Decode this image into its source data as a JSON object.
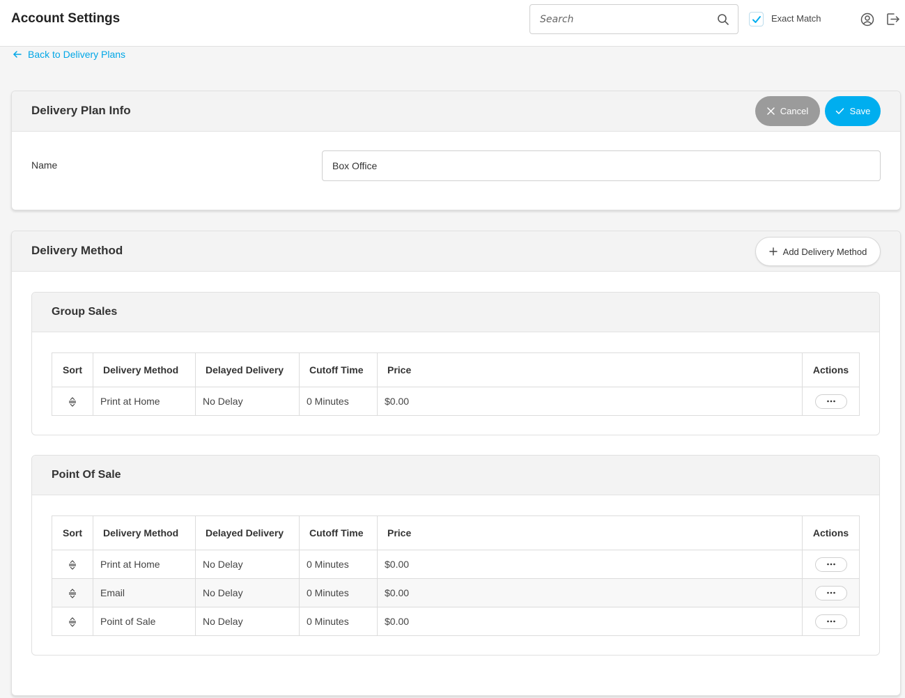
{
  "header": {
    "title": "Account Settings",
    "search_placeholder": "Search",
    "search_value": "",
    "exact_match_label": "Exact Match",
    "exact_match_checked": true
  },
  "back_link": {
    "label": "Back to Delivery Plans"
  },
  "plan_info": {
    "title": "Delivery Plan Info",
    "cancel_label": "Cancel",
    "save_label": "Save",
    "name_label": "Name",
    "name_value": "Box Office"
  },
  "delivery_method": {
    "title": "Delivery Method",
    "add_label": "Add Delivery Method",
    "columns": [
      "Sort",
      "Delivery Method",
      "Delayed Delivery",
      "Cutoff Time",
      "Price",
      "Actions"
    ],
    "groups": [
      {
        "title": "Group Sales",
        "rows": [
          {
            "method": "Print at Home",
            "delay": "No Delay",
            "cutoff": "0 Minutes",
            "price": "$0.00"
          }
        ]
      },
      {
        "title": "Point Of Sale",
        "rows": [
          {
            "method": "Print at Home",
            "delay": "No Delay",
            "cutoff": "0 Minutes",
            "price": "$0.00"
          },
          {
            "method": "Email",
            "delay": "No Delay",
            "cutoff": "0 Minutes",
            "price": "$0.00"
          },
          {
            "method": "Point of Sale",
            "delay": "No Delay",
            "cutoff": "0 Minutes",
            "price": "$0.00"
          }
        ]
      }
    ]
  },
  "colors": {
    "accent": "#00aeef",
    "link": "#00a6e6",
    "cancel_bg": "#9b9b9b"
  }
}
